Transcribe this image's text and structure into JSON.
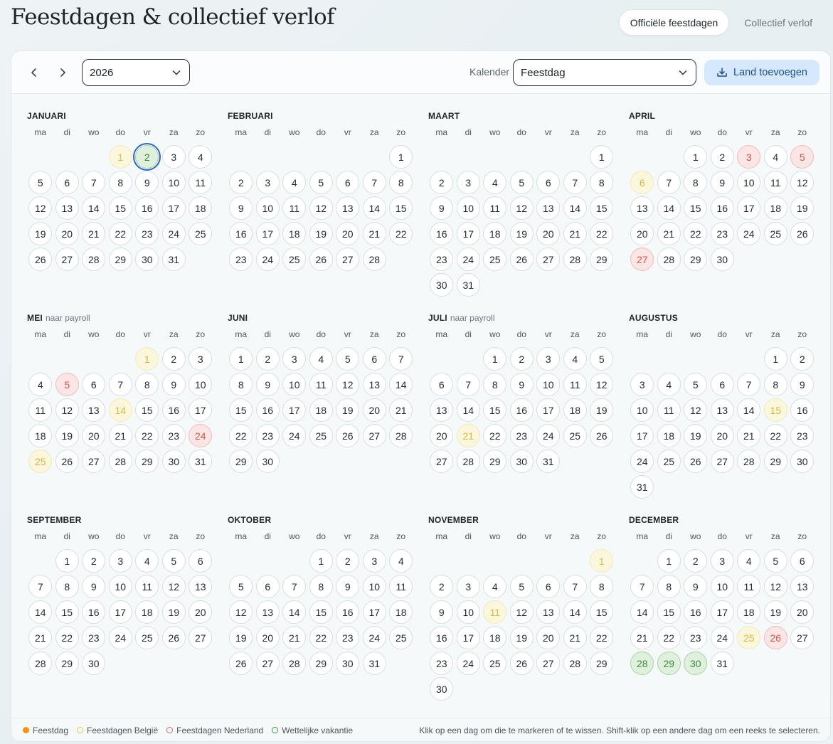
{
  "page": {
    "title": "Feestdagen & collectief verlof",
    "tabs": [
      {
        "label": "Officiële feestdagen",
        "active": true
      },
      {
        "label": "Collectief verlof",
        "active": false
      }
    ]
  },
  "toolbar": {
    "year": "2026",
    "calendar_label": "Kalender",
    "calendar_value": "Feestdag",
    "add_button": "Land toevoegen"
  },
  "weekdays": [
    "ma",
    "di",
    "wo",
    "do",
    "vr",
    "za",
    "zo"
  ],
  "months": [
    {
      "name": "JANUARI",
      "note": "",
      "offset": 3,
      "days": 31,
      "marks": {
        "1": "be",
        "2": "vak"
      },
      "selected": 2
    },
    {
      "name": "FEBRUARI",
      "note": "",
      "offset": 6,
      "days": 28,
      "marks": {}
    },
    {
      "name": "MAART",
      "note": "",
      "offset": 6,
      "days": 31,
      "marks": {}
    },
    {
      "name": "APRIL",
      "note": "",
      "offset": 2,
      "days": 30,
      "marks": {
        "3": "nl",
        "5": "nl",
        "6": "be",
        "27": "nl"
      }
    },
    {
      "name": "MEI",
      "note": "naar payroll",
      "offset": 4,
      "days": 31,
      "marks": {
        "1": "be",
        "5": "nl",
        "14": "be",
        "24": "nl",
        "25": "be"
      }
    },
    {
      "name": "JUNI",
      "note": "",
      "offset": 0,
      "days": 30,
      "marks": {}
    },
    {
      "name": "JULI",
      "note": "naar payroll",
      "offset": 2,
      "days": 31,
      "marks": {
        "21": "be"
      }
    },
    {
      "name": "AUGUSTUS",
      "note": "",
      "offset": 5,
      "days": 31,
      "marks": {
        "15": "be"
      }
    },
    {
      "name": "SEPTEMBER",
      "note": "",
      "offset": 1,
      "days": 30,
      "marks": {}
    },
    {
      "name": "OKTOBER",
      "note": "",
      "offset": 3,
      "days": 31,
      "marks": {}
    },
    {
      "name": "NOVEMBER",
      "note": "",
      "offset": 6,
      "days": 30,
      "marks": {
        "1": "be",
        "11": "be"
      }
    },
    {
      "name": "DECEMBER",
      "note": "",
      "offset": 1,
      "days": 31,
      "marks": {
        "25": "be",
        "26": "nl",
        "28": "vak",
        "29": "vak",
        "30": "vak"
      }
    }
  ],
  "legend": {
    "items": [
      {
        "label": "Feestdag",
        "color": "#f0960e",
        "filled": true
      },
      {
        "label": "Feestdagen België",
        "color": "#e6c84a",
        "filled": false
      },
      {
        "label": "Feestdagen Nederland",
        "color": "#e06666",
        "filled": false
      },
      {
        "label": "Wettelijke vakantie",
        "color": "#3d9b3d",
        "filled": false
      }
    ],
    "hint": "Klik op een dag om die te markeren of te wissen. Shift-klik op een andere dag om een reeks te selecteren."
  }
}
